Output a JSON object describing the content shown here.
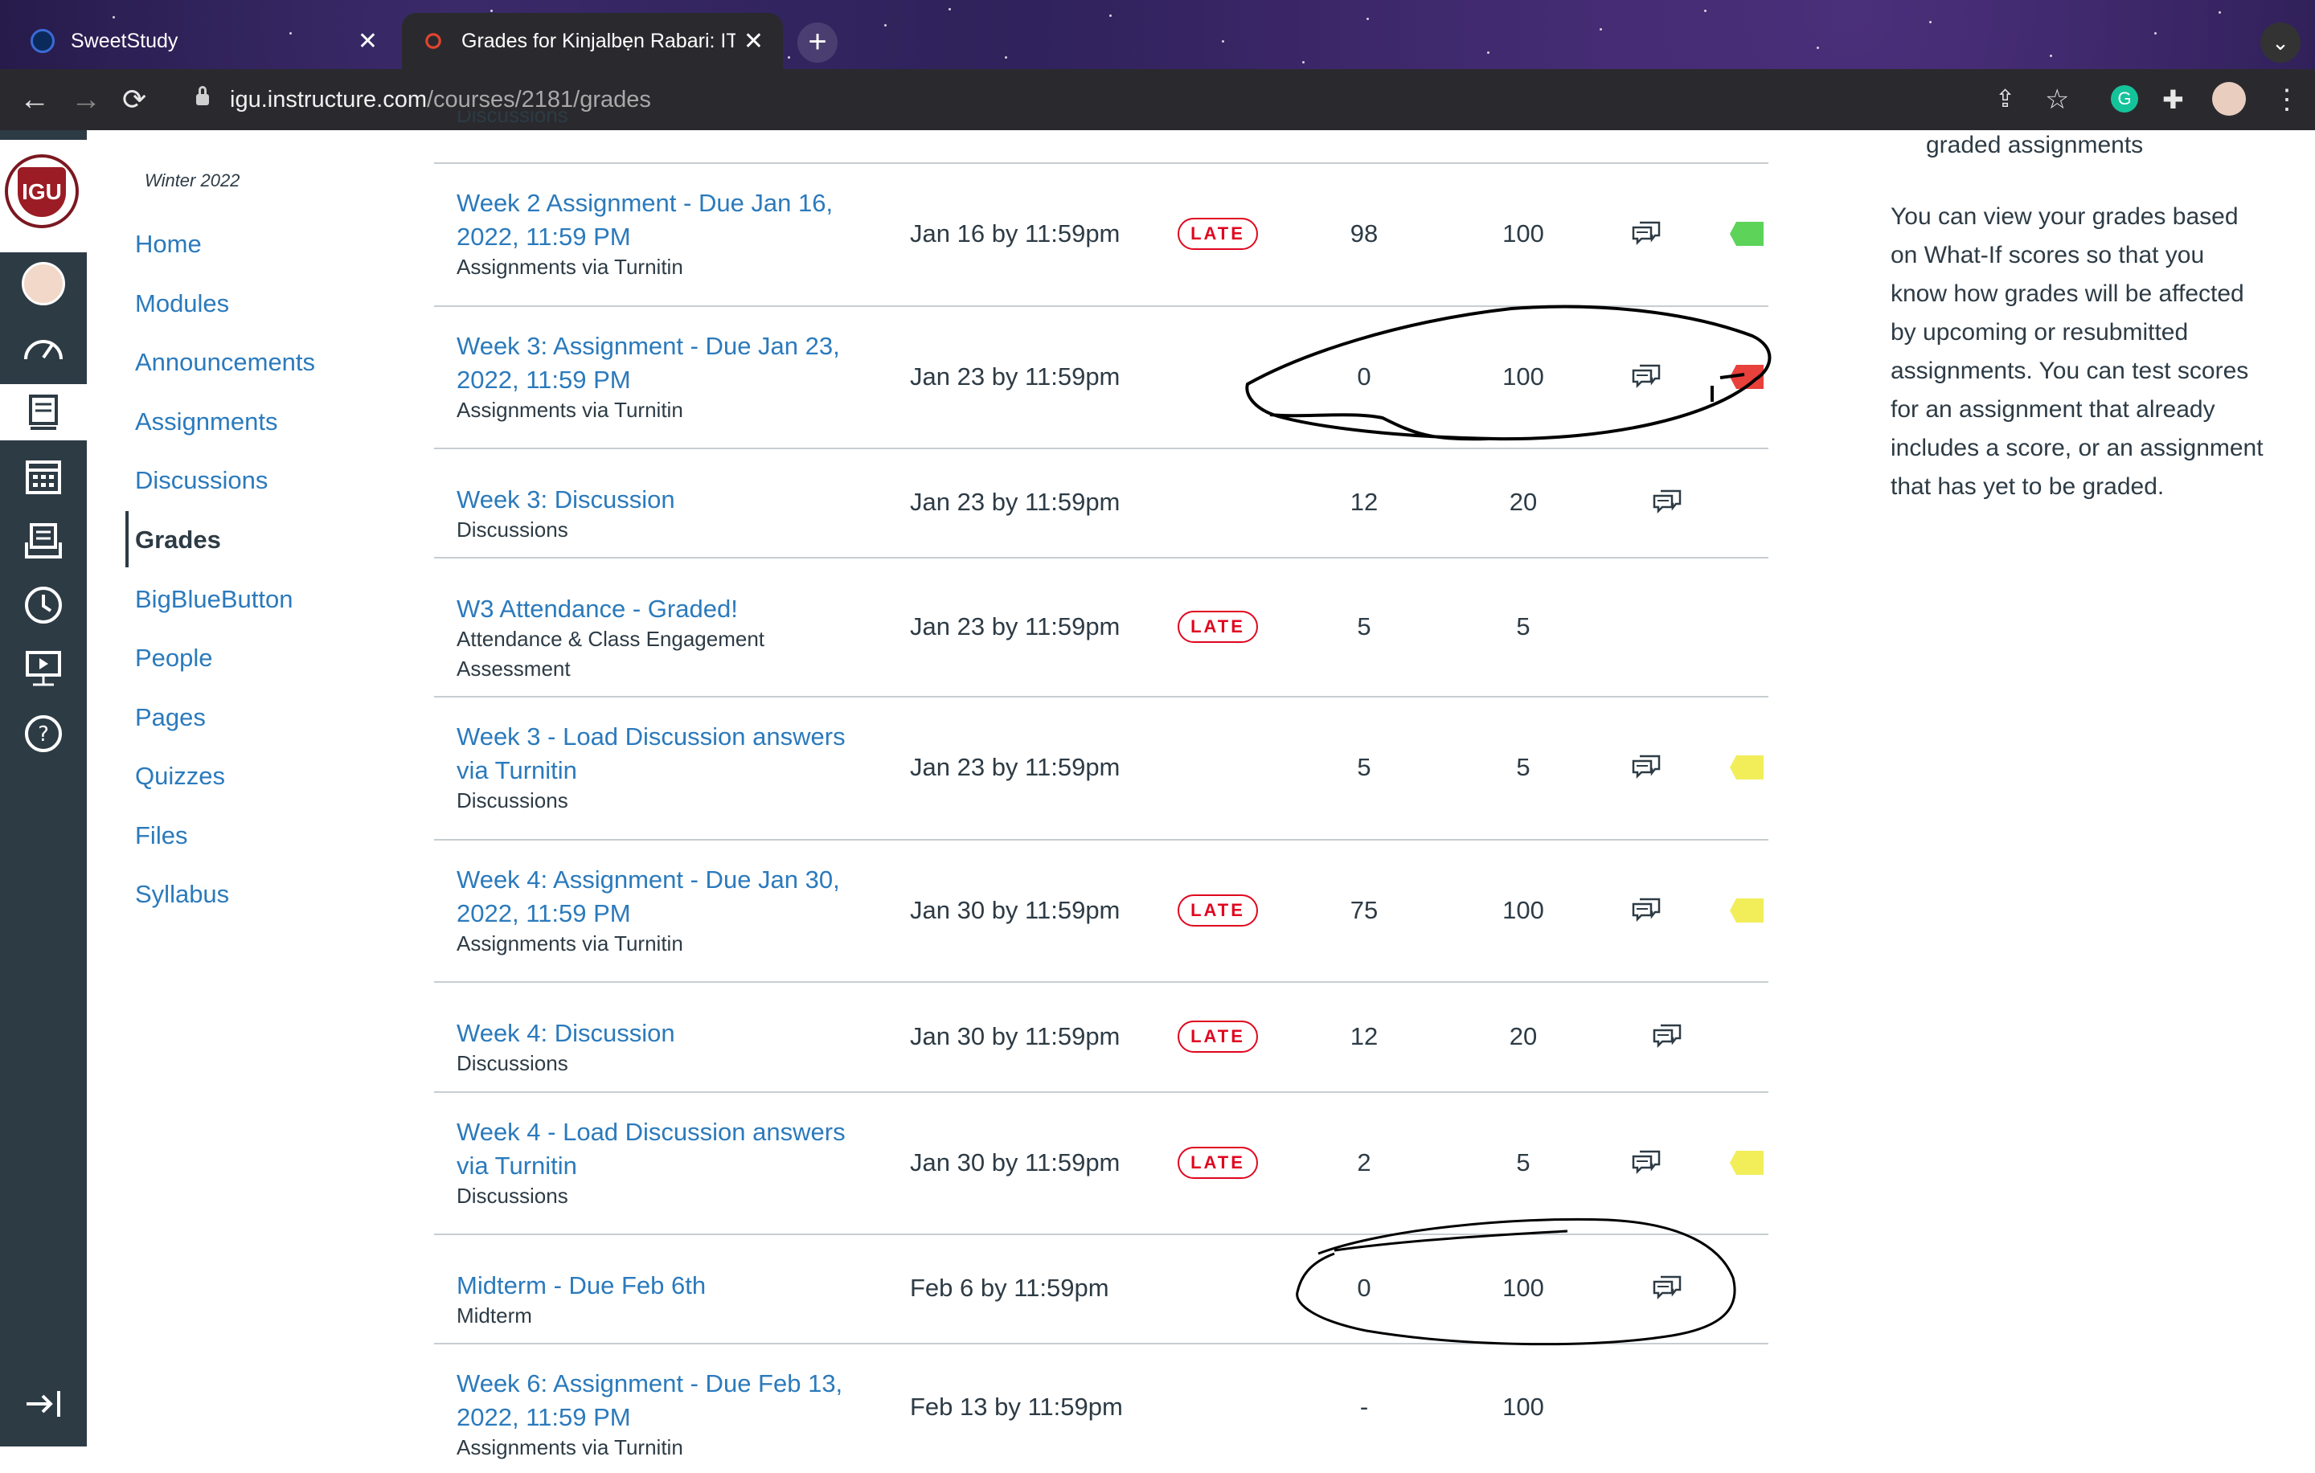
{
  "browser": {
    "tabs": [
      {
        "title": "SweetStudy"
      },
      {
        "title": "Grades for Kinjalben Rabari: IT"
      }
    ],
    "url_host": "igu.instructure.com",
    "url_path": "/courses/2181/grades"
  },
  "course_nav": {
    "term": "Winter 2022",
    "items": [
      "Home",
      "Modules",
      "Announcements",
      "Assignments",
      "Discussions",
      "Grades",
      "BigBlueButton",
      "People",
      "Pages",
      "Quizzes",
      "Files",
      "Syllabus"
    ],
    "active": "Grades"
  },
  "logo_text": "IGU",
  "grades": {
    "partial_top_label": "Discussions",
    "rows": [
      {
        "title": "Week 2 Assignment - Due Jan 16, 2022, 11:59 PM",
        "title_lines": [
          "Week 2 Assignment - Due Jan 16,",
          "2022, 11:59 PM"
        ],
        "type": "Assignments via Turnitin",
        "due": "Jan 16 by 11:59pm",
        "late": true,
        "score": "98",
        "out_of": "100",
        "comment": true,
        "flag": "green"
      },
      {
        "title": "Week 3: Assignment - Due Jan 23, 2022, 11:59 PM",
        "title_lines": [
          "Week 3: Assignment - Due Jan 23,",
          "2022, 11:59 PM"
        ],
        "type": "Assignments via Turnitin",
        "due": "Jan 23 by 11:59pm",
        "late": false,
        "score": "0",
        "out_of": "100",
        "comment": true,
        "flag": "red"
      },
      {
        "title": "Week 3: Discussion",
        "title_lines": [
          "Week 3: Discussion"
        ],
        "type": "Discussions",
        "due": "Jan 23 by 11:59pm",
        "late": false,
        "score": "12",
        "out_of": "20",
        "comment": true,
        "flag": null
      },
      {
        "title": "W3 Attendance - Graded!",
        "title_lines": [
          "W3 Attendance - Graded!"
        ],
        "type_lines": [
          "Attendance & Class Engagement",
          "Assessment"
        ],
        "due": "Jan 23 by 11:59pm",
        "late": true,
        "score": "5",
        "out_of": "5",
        "comment": false,
        "flag": null
      },
      {
        "title": "Week 3 - Load Discussion answers via Turnitin",
        "title_lines": [
          "Week 3 - Load Discussion answers",
          "via Turnitin"
        ],
        "type": "Discussions",
        "due": "Jan 23 by 11:59pm",
        "late": false,
        "score": "5",
        "out_of": "5",
        "comment": true,
        "flag": "yellow"
      },
      {
        "title": "Week 4: Assignment - Due Jan 30, 2022, 11:59 PM",
        "title_lines": [
          "Week 4: Assignment - Due Jan 30,",
          "2022, 11:59 PM"
        ],
        "type": "Assignments via Turnitin",
        "due": "Jan 30 by 11:59pm",
        "late": true,
        "score": "75",
        "out_of": "100",
        "comment": true,
        "flag": "yellow"
      },
      {
        "title": "Week 4: Discussion",
        "title_lines": [
          "Week 4: Discussion"
        ],
        "type": "Discussions",
        "due": "Jan 30 by 11:59pm",
        "late": true,
        "score": "12",
        "out_of": "20",
        "comment": true,
        "flag": null
      },
      {
        "title": "Week 4 - Load Discussion answers via Turnitin",
        "title_lines": [
          "Week 4 - Load Discussion answers",
          "via Turnitin"
        ],
        "type": "Discussions",
        "due": "Jan 30 by 11:59pm",
        "late": true,
        "score": "2",
        "out_of": "5",
        "comment": true,
        "flag": "yellow"
      },
      {
        "title": "Midterm - Due Feb 6th",
        "title_lines": [
          "Midterm - Due Feb 6th"
        ],
        "type": "Midterm",
        "due": "Feb 6 by 11:59pm",
        "late": false,
        "score": "0",
        "out_of": "100",
        "comment": true,
        "flag": null
      },
      {
        "title": "Week 6: Assignment - Due Feb 13, 2022, 11:59 PM",
        "title_lines": [
          "Week 6: Assignment - Due Feb 13,",
          "2022, 11:59 PM"
        ],
        "type": "Assignments via Turnitin",
        "due": "Feb 13 by 11:59pm",
        "late": false,
        "score": "-",
        "out_of": "100",
        "comment": false,
        "flag": null
      }
    ],
    "late_label": "LATE"
  },
  "sidebar": {
    "top_fragment": "graded assignments",
    "lines": [
      "You can view your grades based",
      "on What-If scores so that you",
      "know how grades will be affected",
      "by upcoming or resubmitted",
      "assignments. You can test scores",
      "for an assignment that already",
      "includes a score, or an assignment",
      "that has yet to be graded."
    ]
  },
  "colors": {
    "link": "#2b7abc",
    "text": "#2d3b45",
    "late": "#e0061f",
    "flag_green": "#5dd35a",
    "flag_red": "#e8403a",
    "flag_yellow": "#f2ee5a",
    "nav_bg": "#2d3b45"
  }
}
